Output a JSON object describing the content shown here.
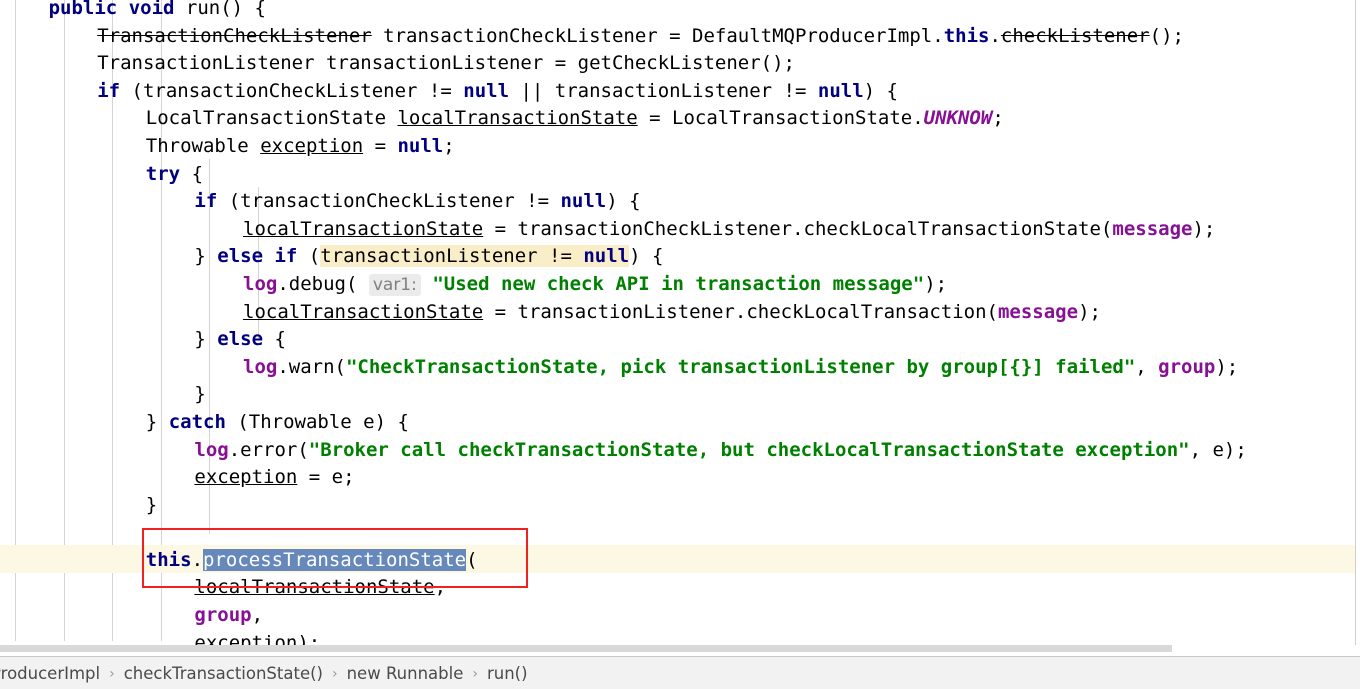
{
  "editor": {
    "type": "java-source-editor",
    "background": "#ffffff",
    "current_line_highlight_color": "#fdf8e4",
    "indent_guide_color": "#d4d4d4",
    "annotation_box_color": "#ee2222",
    "selection_color": "#6688bb",
    "search_highlight_color": "#faeec8",
    "colors": {
      "keyword": "#000080",
      "string": "#008000",
      "field": "#871094",
      "static_field": "#871094",
      "plain_text": "#000000",
      "param_hint_bg": "#ebebeb",
      "param_hint_fg": "#808080"
    },
    "selected_text": "processTransactionState",
    "search_match_text": "transactionListener != null",
    "parameter_hint": "var1:",
    "lines": [
      {
        "indent": 2,
        "tokens": [
          {
            "t": "public",
            "c": "kw"
          },
          {
            "t": " ",
            "c": "plain"
          },
          {
            "t": "void",
            "c": "kw"
          },
          {
            "t": " run() {",
            "c": "plain"
          }
        ]
      },
      {
        "indent": 3,
        "tokens": [
          {
            "t": "TransactionCheckListener",
            "c": "depr"
          },
          {
            "t": " transactionCheckListener = DefaultMQProducerImpl.",
            "c": "plain"
          },
          {
            "t": "this",
            "c": "kw"
          },
          {
            "t": ".",
            "c": "plain"
          },
          {
            "t": "checkListener",
            "c": "depr"
          },
          {
            "t": "();",
            "c": "plain"
          }
        ]
      },
      {
        "indent": 3,
        "tokens": [
          {
            "t": "TransactionListener transactionListener = getCheckListener();",
            "c": "plain"
          }
        ]
      },
      {
        "indent": 3,
        "tokens": [
          {
            "t": "if",
            "c": "kw"
          },
          {
            "t": " (transactionCheckListener != ",
            "c": "plain"
          },
          {
            "t": "null",
            "c": "kw"
          },
          {
            "t": " || transactionListener != ",
            "c": "plain"
          },
          {
            "t": "null",
            "c": "kw"
          },
          {
            "t": ") {",
            "c": "plain"
          }
        ]
      },
      {
        "indent": 4,
        "tokens": [
          {
            "t": "LocalTransactionState ",
            "c": "plain"
          },
          {
            "t": "localTransactionState",
            "c": "local"
          },
          {
            "t": " = LocalTransactionState.",
            "c": "plain"
          },
          {
            "t": "UNKNOW",
            "c": "sfield"
          },
          {
            "t": ";",
            "c": "plain"
          }
        ]
      },
      {
        "indent": 4,
        "tokens": [
          {
            "t": "Throwable ",
            "c": "plain"
          },
          {
            "t": "exception",
            "c": "local"
          },
          {
            "t": " = ",
            "c": "plain"
          },
          {
            "t": "null",
            "c": "kw"
          },
          {
            "t": ";",
            "c": "plain"
          }
        ]
      },
      {
        "indent": 4,
        "tokens": [
          {
            "t": "try",
            "c": "kw"
          },
          {
            "t": " {",
            "c": "plain"
          }
        ]
      },
      {
        "indent": 5,
        "tokens": [
          {
            "t": "if",
            "c": "kw"
          },
          {
            "t": " (transactionCheckListener != ",
            "c": "plain"
          },
          {
            "t": "null",
            "c": "kw"
          },
          {
            "t": ") {",
            "c": "plain"
          }
        ]
      },
      {
        "indent": 6,
        "tokens": [
          {
            "t": "localTransactionState",
            "c": "local"
          },
          {
            "t": " = transactionCheckListener.checkLocalTransactionState(",
            "c": "plain"
          },
          {
            "t": "message",
            "c": "field"
          },
          {
            "t": ");",
            "c": "plain"
          }
        ]
      },
      {
        "indent": 5,
        "tokens": [
          {
            "t": "} ",
            "c": "plain"
          },
          {
            "t": "else if",
            "c": "kw"
          },
          {
            "t": " (",
            "c": "plain"
          },
          {
            "t": "transactionListener != ",
            "c": "searchhl"
          },
          {
            "t": "null",
            "c": "kw searchhl"
          },
          {
            "t": ") {",
            "c": "plain"
          }
        ]
      },
      {
        "indent": 6,
        "tokens": [
          {
            "t": "log",
            "c": "field"
          },
          {
            "t": ".debug( ",
            "c": "plain"
          },
          {
            "t": "var1:",
            "c": "hint"
          },
          {
            "t": " ",
            "c": "plain"
          },
          {
            "t": "\"Used new check API in transaction message\"",
            "c": "str"
          },
          {
            "t": ");",
            "c": "plain"
          }
        ]
      },
      {
        "indent": 6,
        "tokens": [
          {
            "t": "localTransactionState",
            "c": "local"
          },
          {
            "t": " = transactionListener.checkLocalTransaction(",
            "c": "plain"
          },
          {
            "t": "message",
            "c": "field"
          },
          {
            "t": ");",
            "c": "plain"
          }
        ]
      },
      {
        "indent": 5,
        "tokens": [
          {
            "t": "} ",
            "c": "plain"
          },
          {
            "t": "else",
            "c": "kw"
          },
          {
            "t": " {",
            "c": "plain"
          }
        ]
      },
      {
        "indent": 6,
        "tokens": [
          {
            "t": "log",
            "c": "field"
          },
          {
            "t": ".warn(",
            "c": "plain"
          },
          {
            "t": "\"CheckTransactionState, pick transactionListener by group[{}] failed\"",
            "c": "str"
          },
          {
            "t": ", ",
            "c": "plain"
          },
          {
            "t": "group",
            "c": "field"
          },
          {
            "t": ");",
            "c": "plain"
          }
        ]
      },
      {
        "indent": 5,
        "tokens": [
          {
            "t": "}",
            "c": "plain"
          }
        ]
      },
      {
        "indent": 4,
        "tokens": [
          {
            "t": "} ",
            "c": "plain"
          },
          {
            "t": "catch",
            "c": "kw"
          },
          {
            "t": " (Throwable e) {",
            "c": "plain"
          }
        ]
      },
      {
        "indent": 5,
        "tokens": [
          {
            "t": "log",
            "c": "field"
          },
          {
            "t": ".error(",
            "c": "plain"
          },
          {
            "t": "\"Broker call checkTransactionState, but checkLocalTransactionState exception\"",
            "c": "str"
          },
          {
            "t": ", e);",
            "c": "plain"
          }
        ]
      },
      {
        "indent": 5,
        "tokens": [
          {
            "t": "exception",
            "c": "local"
          },
          {
            "t": " = e;",
            "c": "plain"
          }
        ]
      },
      {
        "indent": 4,
        "tokens": [
          {
            "t": "}",
            "c": "plain"
          }
        ]
      },
      {
        "indent": 0,
        "tokens": []
      },
      {
        "indent": 4,
        "tokens": [
          {
            "t": "this",
            "c": "kw"
          },
          {
            "t": ".",
            "c": "plain"
          },
          {
            "t": "processTransactionState",
            "c": "selhl"
          },
          {
            "t": "(",
            "c": "plain"
          }
        ]
      },
      {
        "indent": 5,
        "tokens": [
          {
            "t": "localTransactionState",
            "c": "local"
          },
          {
            "t": ",",
            "c": "plain"
          }
        ]
      },
      {
        "indent": 5,
        "tokens": [
          {
            "t": "group",
            "c": "field"
          },
          {
            "t": ",",
            "c": "plain"
          }
        ]
      },
      {
        "indent": 5,
        "tokens": [
          {
            "t": "exception",
            "c": "local"
          },
          {
            "t": ");",
            "c": "plain"
          }
        ]
      }
    ]
  },
  "scrollbar": {
    "orientation": "horizontal",
    "thumb_color": "#d9d9d9",
    "track_color": "#ffffff"
  },
  "breadcrumb": {
    "separator": "›",
    "items": [
      {
        "label": "ProducerImpl"
      },
      {
        "label": "checkTransactionState()"
      },
      {
        "label": "new Runnable"
      },
      {
        "label": "run()"
      }
    ]
  }
}
